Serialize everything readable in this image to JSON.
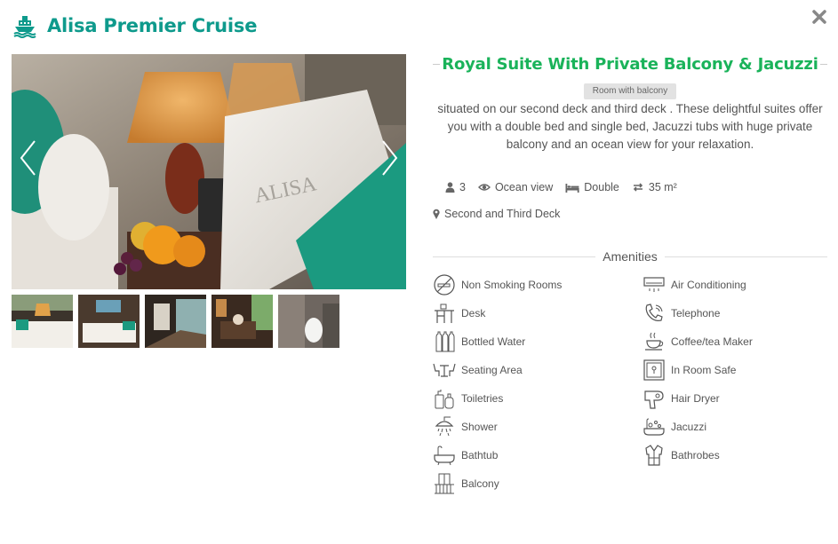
{
  "header": {
    "title": "Alisa Premier Cruise",
    "ship_icon": "ship-icon",
    "close_icon": "close-icon"
  },
  "gallery": {
    "main_photo_text": "ALISA",
    "prev_icon": "chevron-left-icon",
    "next_icon": "chevron-right-icon",
    "thumbnails": [
      "thumbnail-1",
      "thumbnail-2",
      "thumbnail-3",
      "thumbnail-4",
      "thumbnail-5"
    ]
  },
  "room": {
    "title": "Royal Suite With Private Balcony & Jacuzzi",
    "tag": "Room with balcony",
    "description": "situated on our second deck and third deck . These delightful suites offer you with a double bed and single bed, Jacuzzi tubs with huge private balcony and an ocean view for your relaxation.",
    "occupancy": "3",
    "view": "Ocean view",
    "bed": "Double",
    "size": "35 m²",
    "deck": "Second and Third Deck"
  },
  "amenities": {
    "heading": "Amenities",
    "left": [
      {
        "label": "Non Smoking Rooms",
        "icon": "no-smoking-icon"
      },
      {
        "label": "Desk",
        "icon": "desk-icon"
      },
      {
        "label": "Bottled Water",
        "icon": "bottled-water-icon"
      },
      {
        "label": "Seating Area",
        "icon": "seating-area-icon"
      },
      {
        "label": "Toiletries",
        "icon": "toiletries-icon"
      },
      {
        "label": "Shower",
        "icon": "shower-icon"
      },
      {
        "label": "Bathtub",
        "icon": "bathtub-icon"
      },
      {
        "label": "Balcony",
        "icon": "balcony-icon"
      }
    ],
    "right": [
      {
        "label": "Air Conditioning",
        "icon": "air-conditioning-icon"
      },
      {
        "label": "Telephone",
        "icon": "telephone-icon"
      },
      {
        "label": "Coffee/tea Maker",
        "icon": "coffee-maker-icon"
      },
      {
        "label": "In Room Safe",
        "icon": "safe-icon"
      },
      {
        "label": "Hair Dryer",
        "icon": "hair-dryer-icon"
      },
      {
        "label": "Jacuzzi",
        "icon": "jacuzzi-icon"
      },
      {
        "label": "Bathrobes",
        "icon": "bathrobe-icon"
      }
    ]
  },
  "colors": {
    "brand_teal": "#0e9a8c",
    "title_green": "#1ab35a",
    "text_gray": "#555555",
    "tag_bg": "#e2e2e2"
  }
}
